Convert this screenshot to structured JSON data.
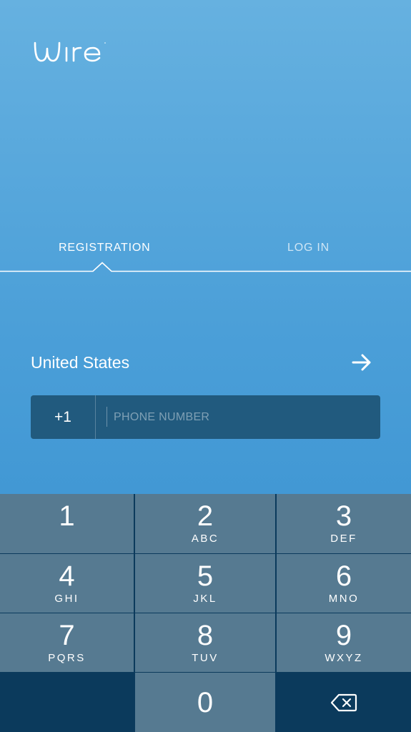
{
  "app": {
    "logo_text": "wire"
  },
  "tabs": {
    "registration": "REGISTRATION",
    "login": "LOG IN"
  },
  "form": {
    "country_name": "United States",
    "country_code": "+1",
    "phone_value": "",
    "phone_placeholder": "PHONE NUMBER"
  },
  "keypad": {
    "keys": [
      {
        "digit": "1",
        "letters": ""
      },
      {
        "digit": "2",
        "letters": "ABC"
      },
      {
        "digit": "3",
        "letters": "DEF"
      },
      {
        "digit": "4",
        "letters": "GHI"
      },
      {
        "digit": "5",
        "letters": "JKL"
      },
      {
        "digit": "6",
        "letters": "MNO"
      },
      {
        "digit": "7",
        "letters": "PQRS"
      },
      {
        "digit": "8",
        "letters": "TUV"
      },
      {
        "digit": "9",
        "letters": "WXYZ"
      },
      {
        "digit": "0",
        "letters": ""
      }
    ]
  },
  "icons": {
    "next": "arrow-right-icon",
    "delete": "backspace-icon"
  },
  "colors": {
    "background_top": "#66b1e0",
    "background_bottom": "#348ecf",
    "input_background": "#215a7e",
    "key_background": "#567a91",
    "keypad_dark": "#0b3a5c"
  }
}
